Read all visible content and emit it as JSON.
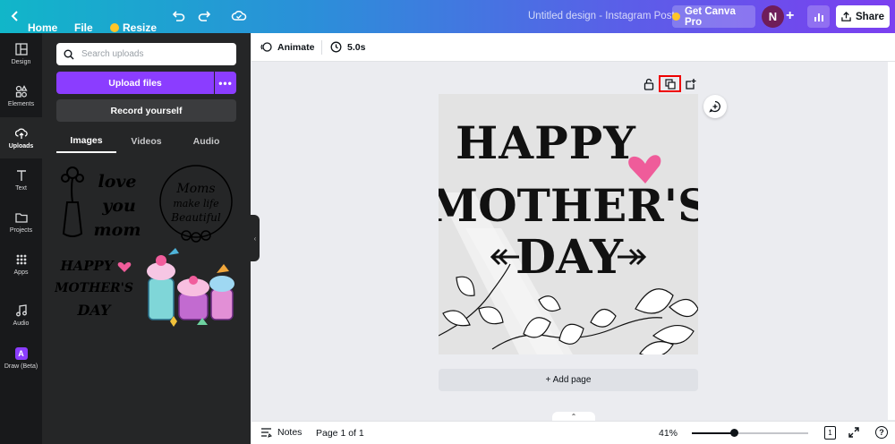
{
  "topbar": {
    "home": "Home",
    "file": "File",
    "resize": "Resize",
    "title": "Untitled design - Instagram Post",
    "pro": "Get Canva Pro",
    "avatar": "N",
    "share": "Share"
  },
  "rail": {
    "items": [
      {
        "label": "Design",
        "icon": "design-icon"
      },
      {
        "label": "Elements",
        "icon": "elements-icon"
      },
      {
        "label": "Uploads",
        "icon": "uploads-icon"
      },
      {
        "label": "Text",
        "icon": "text-icon"
      },
      {
        "label": "Projects",
        "icon": "folder-icon"
      },
      {
        "label": "Apps",
        "icon": "apps-icon"
      },
      {
        "label": "Audio",
        "icon": "music-icon"
      },
      {
        "label": "Draw (Beta)",
        "icon": "draw-icon"
      }
    ],
    "draw_badge": "A"
  },
  "panel": {
    "search_placeholder": "Search uploads",
    "upload": "Upload files",
    "upload_more": "•••",
    "record": "Record yourself",
    "tabs": [
      "Images",
      "Videos",
      "Audio"
    ],
    "thumbs": {
      "t1": [
        "love",
        "you",
        "mom"
      ],
      "t2": [
        "Moms",
        "make life",
        "Beautiful"
      ],
      "t3": [
        "HAPPY",
        "MOTHER'S",
        "DAY"
      ]
    }
  },
  "toolbar": {
    "animate": "Animate",
    "duration": "5.0s"
  },
  "canvas": {
    "line1": "HAPPY",
    "line2": "MOTHER'S",
    "line3": "DAY"
  },
  "add_page": "+ Add page",
  "bottom": {
    "notes": "Notes",
    "page": "Page 1 of 1",
    "zoom": "41%",
    "zoom_fraction": 0.36,
    "pages_count": "1",
    "help": "?"
  },
  "colors": {
    "accent": "#8b3dff",
    "heart": "#ef5c9a",
    "highlight": "#ee0000"
  }
}
